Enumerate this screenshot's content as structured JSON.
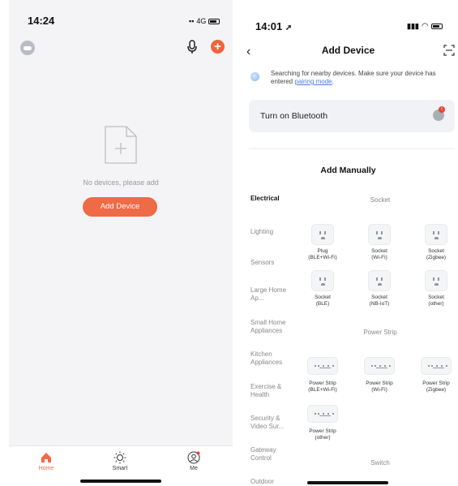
{
  "left": {
    "status": {
      "time": "14:24",
      "network": "4G"
    },
    "empty_text": "No devices, please add",
    "add_device_label": "Add Device",
    "tabs": [
      {
        "label": "Home",
        "icon": "home-icon"
      },
      {
        "label": "Smart",
        "icon": "sun-icon"
      },
      {
        "label": "Me",
        "icon": "profile-icon"
      }
    ],
    "accent": "#ef6a47"
  },
  "right": {
    "status": {
      "time": "14:01"
    },
    "title": "Add Device",
    "search_hint": "Searching for nearby devices. Make sure your device has entered",
    "search_link": "pairing mode",
    "search_hint_end": ".",
    "bluetooth_label": "Turn on Bluetooth",
    "bluetooth_badge": "!",
    "section_title": "Add Manually",
    "categories": [
      "Electrical",
      "Lighting",
      "Sensors",
      "Large Home Ap...",
      "Small Home Appliances",
      "Kitchen Appliances",
      "Exercise & Health",
      "Security & Video Sur...",
      "Gateway Control",
      "Outdoor"
    ],
    "groups": {
      "socket": "Socket",
      "power_strip": "Power Strip",
      "switch": "Switch"
    },
    "sockets": [
      [
        "Plug",
        "(BLE+Wi-Fi)"
      ],
      [
        "Socket",
        "(Wi-Fi)"
      ],
      [
        "Socket",
        "(Zigbee)"
      ],
      [
        "Socket",
        "(BLE)"
      ],
      [
        "Socket",
        "(NB-IoT)"
      ],
      [
        "Socket",
        "(other)"
      ]
    ],
    "strips": [
      [
        "Power Strip",
        "(BLE+Wi-Fi)"
      ],
      [
        "Power Strip",
        "(Wi-Fi)"
      ],
      [
        "Power Strip",
        "(Zigbee)"
      ],
      [
        "Power Strip",
        "(other)"
      ]
    ]
  }
}
